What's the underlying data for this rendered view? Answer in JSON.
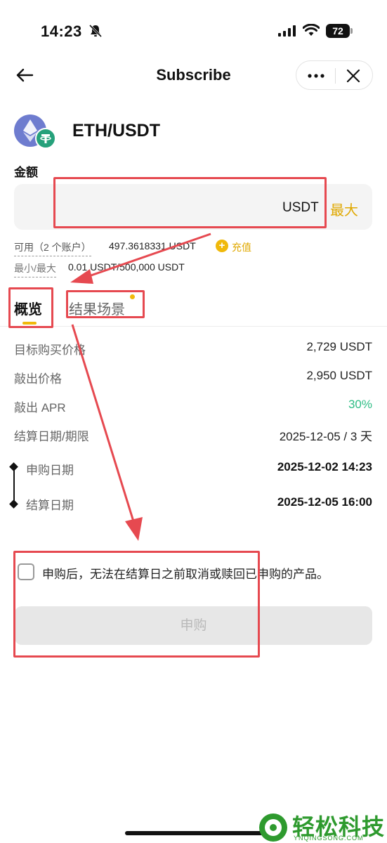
{
  "status_bar": {
    "time": "14:23",
    "battery": "72"
  },
  "header": {
    "title": "Subscribe"
  },
  "pair": {
    "name": "ETH/USDT"
  },
  "amount": {
    "label": "金额",
    "unit": "USDT",
    "max_label": "最大",
    "available_label": "可用（2 个账户）",
    "available_value": "497.3618331 USDT",
    "recharge_label": "充值",
    "limit_label": "最小/最大",
    "limit_value": "0.01 USDT/500,000 USDT"
  },
  "tabs": [
    {
      "label": "概览",
      "active": true
    },
    {
      "label": "结果场景",
      "active": false,
      "has_dot": true
    }
  ],
  "details": [
    {
      "label": "目标购买价格",
      "value": "2,729 USDT"
    },
    {
      "label": "敲出价格",
      "value": "2,950 USDT"
    },
    {
      "label": "敲出 APR",
      "value": "30%"
    },
    {
      "label": "结算日期/期限",
      "value": "2025-12-05 / 3 天"
    }
  ],
  "timeline": [
    {
      "label": "申购日期",
      "value": "2025-12-02 14:23"
    },
    {
      "label": "结算日期",
      "value": "2025-12-05 16:00"
    }
  ],
  "agreement": {
    "text": "申购后，无法在结算日之前取消或赎回已申购的产品。",
    "checked": false
  },
  "submit_label": "申购",
  "watermark": {
    "text": "轻松科技",
    "sub": "YNQINGSONG.COM"
  },
  "colors": {
    "accent": "#f0b90b",
    "positive": "#2ebd85",
    "annotation": "#e64950",
    "watermark": "#2e9a2e"
  }
}
